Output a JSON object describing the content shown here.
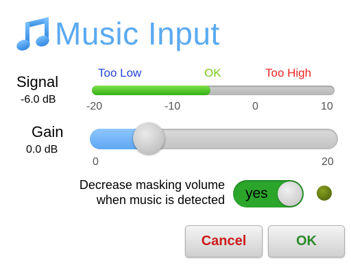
{
  "title": "Music Input",
  "signal": {
    "label": "Signal",
    "value": "-6.0 dB",
    "zones": {
      "low": "Too Low",
      "ok": "OK",
      "high": "Too High"
    },
    "ticks": [
      "-20",
      "-10",
      "0",
      "10"
    ],
    "level_fraction": 0.49
  },
  "gain": {
    "label": "Gain",
    "value": "0.0 dB",
    "min_label": "0",
    "max_label": "20",
    "value_fraction": 0.2
  },
  "masking": {
    "line1": "Decrease masking volume",
    "line2": "when music is detected",
    "toggle_label": "yes"
  },
  "buttons": {
    "cancel": "Cancel",
    "ok": "OK"
  },
  "colors": {
    "title": "#5aaaf0",
    "meter_fill": "#34b014",
    "gain_fill": "#5ea8f2",
    "toggle_on": "#2ba62b",
    "indicator": "#6f8a14",
    "cancel_text": "#cc1b1b",
    "ok_text": "#2a8a2a"
  }
}
